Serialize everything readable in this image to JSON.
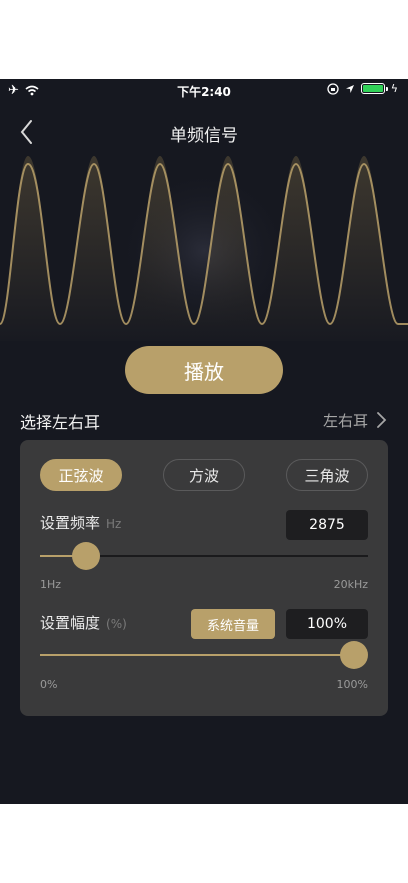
{
  "status_bar": {
    "time": "下午2:40"
  },
  "nav": {
    "title": "单频信号"
  },
  "play_button": "播放",
  "ear": {
    "label": "选择左右耳",
    "value": "左右耳"
  },
  "wave_types": [
    {
      "label": "正弦波",
      "active": true
    },
    {
      "label": "方波",
      "active": false
    },
    {
      "label": "三角波",
      "active": false
    }
  ],
  "frequency": {
    "label": "设置频率",
    "unit": "Hz",
    "value": "2875",
    "min_label": "1Hz",
    "max_label": "20kHz",
    "slider_fraction": 0.14
  },
  "amplitude": {
    "label": "设置幅度",
    "unit": "(%)",
    "system_volume_label": "系统音量",
    "value": "100%",
    "min_label": "0%",
    "max_label": "100%",
    "slider_fraction": 1.0
  },
  "colors": {
    "accent": "#b8a06a",
    "background": "#161820",
    "panel": "#3a3a3b"
  }
}
